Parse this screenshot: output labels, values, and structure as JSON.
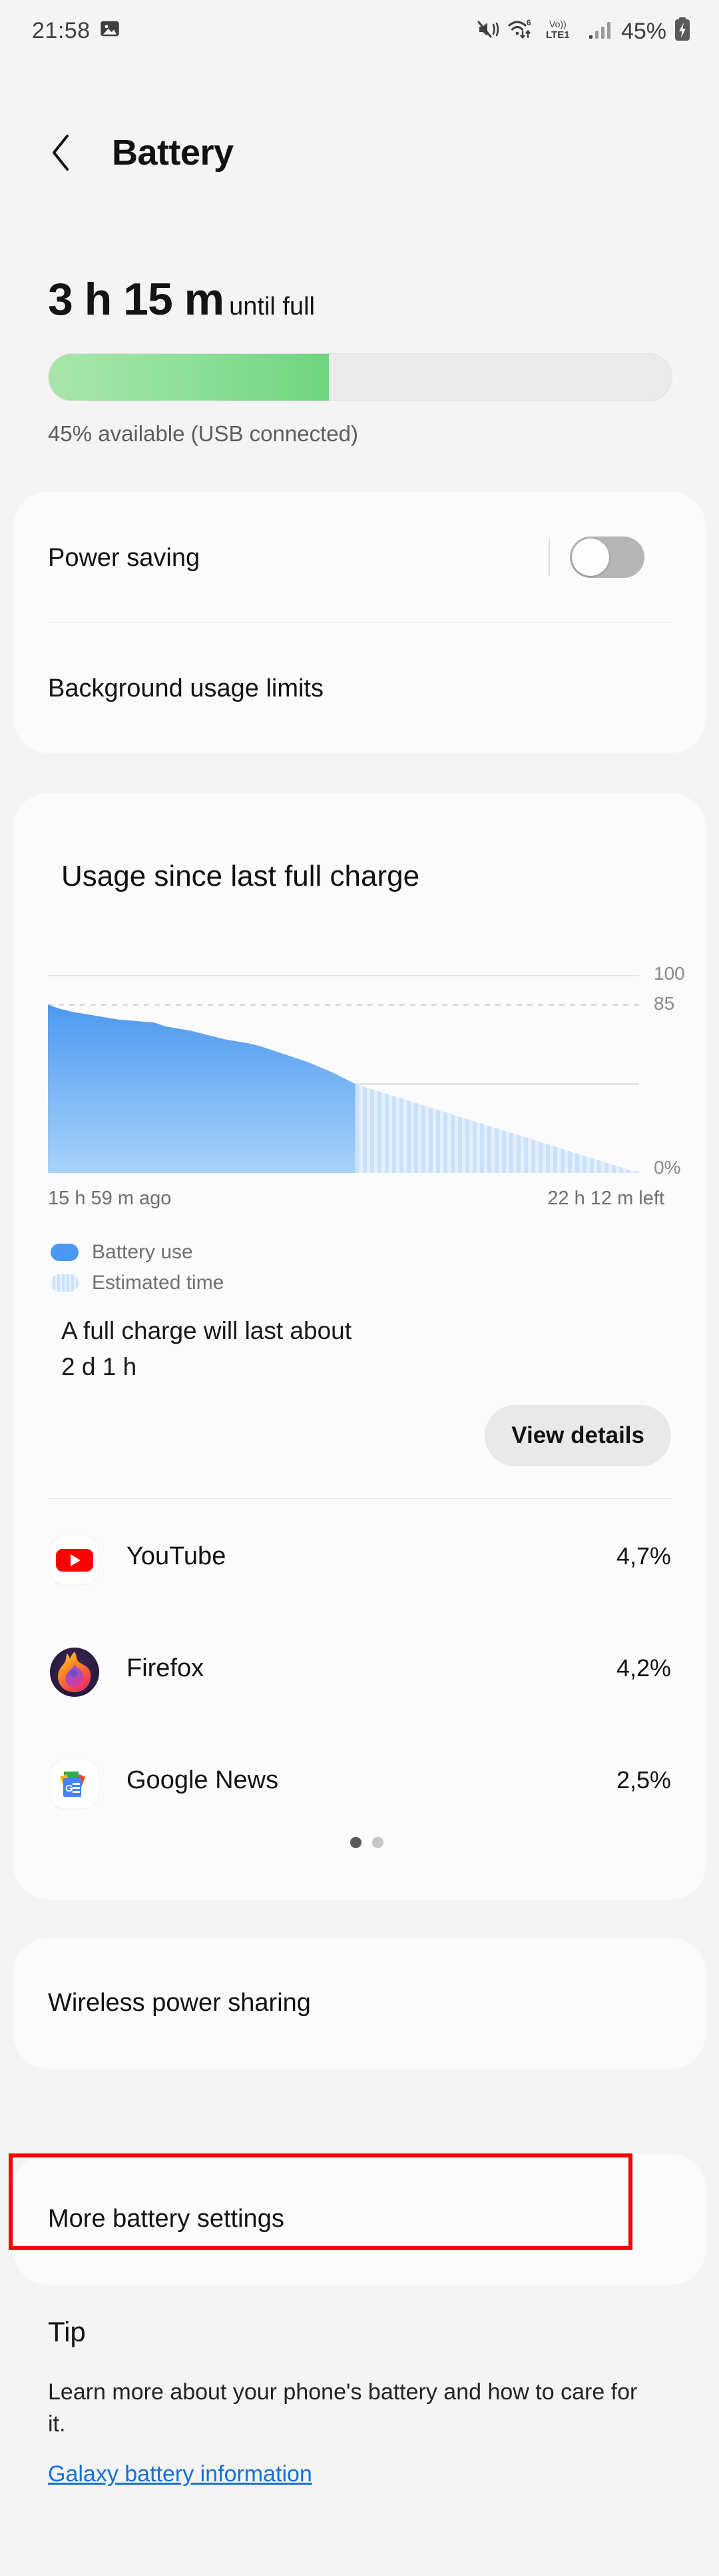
{
  "status_bar": {
    "time": "21:58",
    "icons_left": [
      "image-icon"
    ],
    "icons_right": [
      "mute-vibrate-icon",
      "wifi-6-icon",
      "volte1-icon",
      "signal-bars-icon"
    ],
    "wifi_label": "6",
    "volte_label_top": "Vo))",
    "volte_label_bottom": "LTE1",
    "battery_percent": "45%",
    "battery_icon": "battery-charging-icon"
  },
  "action_bar": {
    "back_icon": "back-chevron-icon",
    "title": "Battery"
  },
  "summary": {
    "time_remaining": "3 h 15 m",
    "time_suffix": "until full",
    "progress_percent": 45,
    "availability": "45% available (USB connected)",
    "fill_color_start": "#a9e5ab",
    "fill_color_end": "#6ed47d"
  },
  "power_card": {
    "power_saving_label": "Power saving",
    "power_saving_on": false,
    "background_limits_label": "Background usage limits"
  },
  "usage_card": {
    "title": "Usage since last full charge",
    "x_label_left": "15 h 59 m ago",
    "x_label_right": "22 h 12 m left",
    "legend": [
      {
        "label": "Battery use",
        "style": "solid",
        "color": "#4a98f0"
      },
      {
        "label": "Estimated time",
        "style": "striped",
        "color": "#cfe4fb"
      }
    ],
    "full_charge_line1": "A full charge will last about",
    "full_charge_line2": "2 d 1 h",
    "view_details_label": "View details",
    "apps": [
      {
        "name": "YouTube",
        "percent": "4,7%",
        "icon": "youtube-icon"
      },
      {
        "name": "Firefox",
        "percent": "4,2%",
        "icon": "firefox-icon"
      },
      {
        "name": "Google News",
        "percent": "2,5%",
        "icon": "google-news-icon"
      }
    ],
    "page_dots": {
      "count": 2,
      "active_index": 0
    }
  },
  "chart_data": {
    "type": "area",
    "title": "Usage since last full charge",
    "xlabel": "",
    "ylabel": "%",
    "ylim": [
      0,
      100
    ],
    "y_ticks": [
      100,
      85,
      0
    ],
    "y_tick_labels": [
      "100",
      "85",
      "0%"
    ],
    "gridlines": [
      {
        "value": 100,
        "style": "solid",
        "labeled": true
      },
      {
        "value": 85,
        "style": "dotted",
        "labeled": true
      },
      {
        "value": 45,
        "style": "solid",
        "labeled": false
      }
    ],
    "x_start_label": "15 h 59 m ago",
    "x_end_label": "22 h 12 m left",
    "series": [
      {
        "name": "Battery use",
        "style": "solid",
        "color": "#4a98f0",
        "x": [
          0,
          2,
          4,
          6,
          8,
          10,
          12,
          14,
          16,
          18,
          20,
          22,
          24,
          26,
          28,
          30,
          32,
          34,
          36,
          38,
          40,
          42,
          44,
          46,
          48,
          50,
          52
        ],
        "values": [
          85,
          83,
          81.5,
          80.5,
          79.5,
          78.5,
          77.5,
          77,
          76.5,
          76,
          74,
          73,
          72,
          70.5,
          69,
          67.5,
          66.5,
          65.5,
          64,
          62,
          60,
          58,
          56,
          53.5,
          51,
          48,
          45
        ]
      },
      {
        "name": "Estimated time",
        "style": "striped",
        "color": "#cfe4fb",
        "x": [
          52,
          100
        ],
        "values": [
          45,
          0
        ]
      }
    ]
  },
  "wireless_card": {
    "label": "Wireless power sharing"
  },
  "more_settings_card": {
    "label": "More battery settings",
    "highlighted": true,
    "highlight_color": "#fb0000"
  },
  "tip": {
    "title": "Tip",
    "body": "Learn more about your phone's battery and how to care for it.",
    "link": "Galaxy battery information",
    "link_color": "#1271d8"
  }
}
